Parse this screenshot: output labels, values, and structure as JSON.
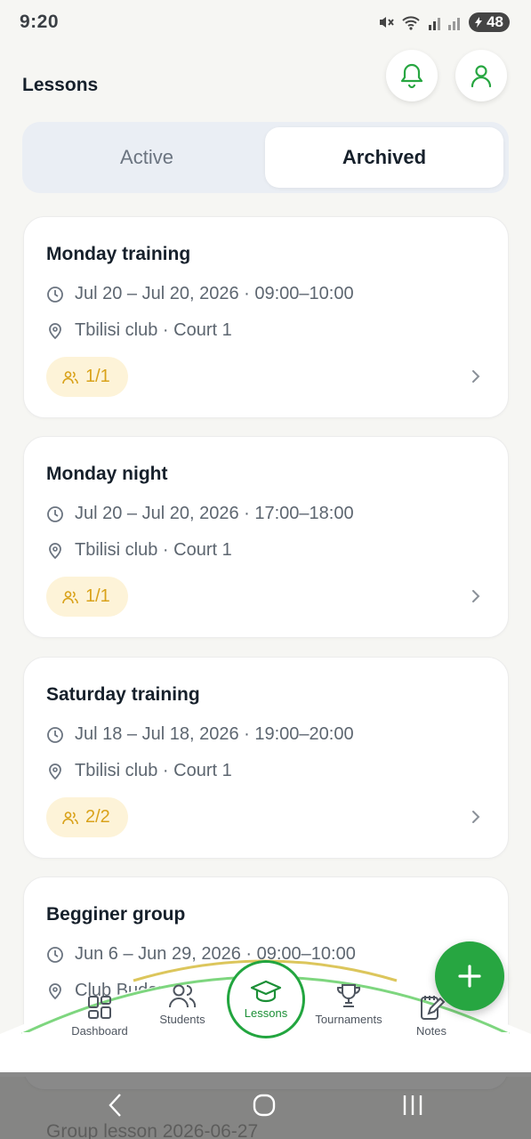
{
  "status_bar": {
    "time": "9:20",
    "battery": "48"
  },
  "header": {
    "title": "Lessons",
    "icons": [
      "bell-icon",
      "user-icon"
    ]
  },
  "tabs": [
    {
      "label": "Active",
      "selected": false
    },
    {
      "label": "Archived",
      "selected": true
    }
  ],
  "lessons": [
    {
      "title": "Monday training",
      "time": "Jul 20 – Jul 20, 2026 · 09:00–10:00",
      "location": "Tbilisi club · Court 1",
      "participants": "1/1"
    },
    {
      "title": "Monday night",
      "time": "Jul 20 – Jul 20, 2026 · 17:00–18:00",
      "location": "Tbilisi club · Court 1",
      "participants": "1/1"
    },
    {
      "title": "Saturday training",
      "time": "Jul 18 – Jul 18, 2026 · 19:00–20:00",
      "location": "Tbilisi club · Court 1",
      "participants": "2/2"
    },
    {
      "title": "Begginer group",
      "time": "Jun 6 – Jun 29, 2026 · 09:00–10:00",
      "location": "Club Budapest",
      "participants": ""
    }
  ],
  "next_card_peek": "Group lesson 2026-06-27",
  "bottom_nav": [
    {
      "label": "Dashboard",
      "icon": "dashboard-icon"
    },
    {
      "label": "Students",
      "icon": "users-icon"
    },
    {
      "label": "Lessons",
      "icon": "graduation-cap-icon",
      "active": true
    },
    {
      "label": "Tournaments",
      "icon": "trophy-icon"
    },
    {
      "label": "Notes",
      "icon": "notes-icon"
    }
  ],
  "fab_icon": "plus-icon",
  "colors": {
    "accent_green": "#27a641",
    "badge_bg": "#fdf3d8",
    "badge_text": "#d9a21a",
    "background": "#f6f6f3"
  }
}
